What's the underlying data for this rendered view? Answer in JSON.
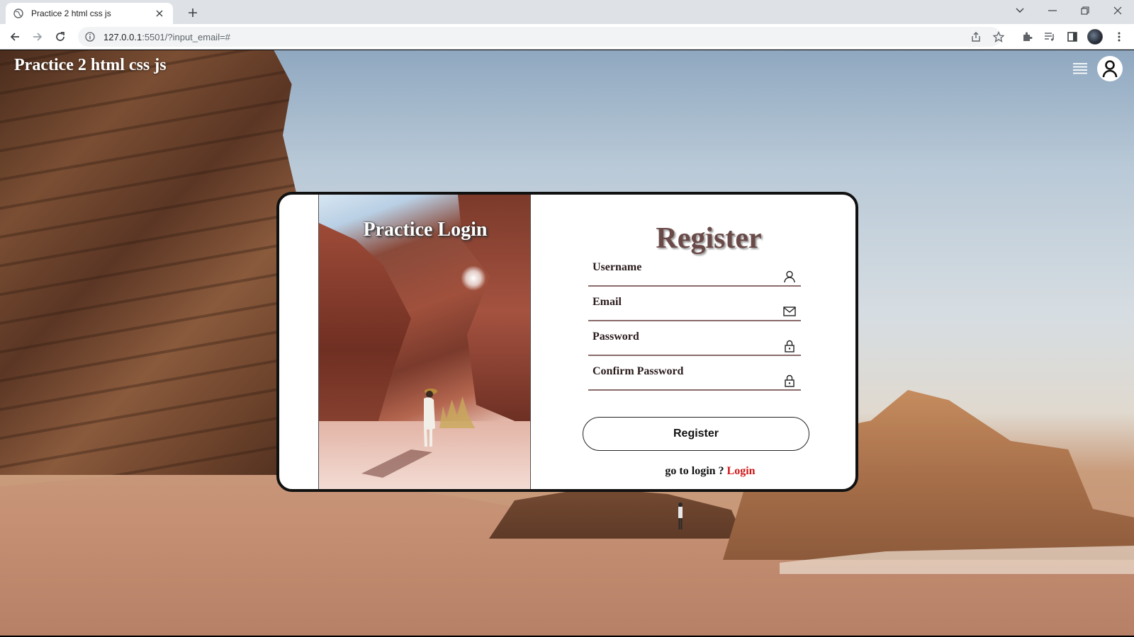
{
  "browser": {
    "tab_title": "Practice 2 html css js",
    "url_host": "127.0.0.1",
    "url_rest": ":5501/?input_email=#"
  },
  "page": {
    "site_title": "Practice 2 html css js",
    "image_title": "Practice Login",
    "form": {
      "title": "Register",
      "fields": [
        {
          "label": "Username",
          "icon": "user-icon"
        },
        {
          "label": "Email",
          "icon": "mail-icon"
        },
        {
          "label": "Password",
          "icon": "lock-icon"
        },
        {
          "label": "Confirm Password",
          "icon": "lock-icon"
        }
      ],
      "submit_label": "Register",
      "login_prompt": "go to login ? ",
      "login_link": "Login"
    }
  },
  "colors": {
    "title_text": "#6a4a48",
    "link": "#d01818",
    "card_border": "#111111"
  }
}
